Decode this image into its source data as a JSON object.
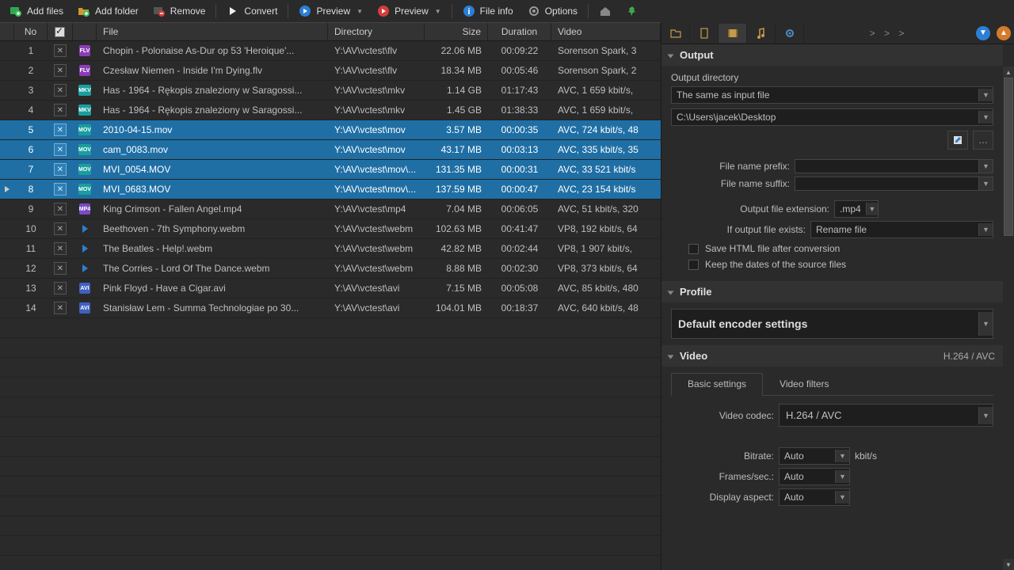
{
  "toolbar": {
    "add_files": "Add files",
    "add_folder": "Add folder",
    "remove": "Remove",
    "convert": "Convert",
    "preview1": "Preview",
    "preview2": "Preview",
    "file_info": "File info",
    "options": "Options"
  },
  "headers": {
    "no": "No",
    "file": "File",
    "directory": "Directory",
    "size": "Size",
    "duration": "Duration",
    "video": "Video"
  },
  "rows": [
    {
      "no": "1",
      "type": "flv",
      "file": "Chopin - Polonaise As-Dur op 53 'Heroique'...",
      "dir": "Y:\\AV\\vctest\\flv",
      "size": "22.06 MB",
      "dur": "00:09:22",
      "video": "Sorenson Spark, 3",
      "sel": false
    },
    {
      "no": "2",
      "type": "flv",
      "file": "Czesław Niemen - Inside I'm Dying.flv",
      "dir": "Y:\\AV\\vctest\\flv",
      "size": "18.34 MB",
      "dur": "00:05:46",
      "video": "Sorenson Spark, 2",
      "sel": false
    },
    {
      "no": "3",
      "type": "mkv",
      "file": "Has - 1964 - Rękopis znaleziony w Saragossi...",
      "dir": "Y:\\AV\\vctest\\mkv",
      "size": "1.14 GB",
      "dur": "01:17:43",
      "video": "AVC, 1 659 kbit/s,",
      "sel": false
    },
    {
      "no": "4",
      "type": "mkv",
      "file": "Has - 1964 - Rękopis znaleziony w Saragossi...",
      "dir": "Y:\\AV\\vctest\\mkv",
      "size": "1.45 GB",
      "dur": "01:38:33",
      "video": "AVC, 1 659 kbit/s,",
      "sel": false
    },
    {
      "no": "5",
      "type": "mov",
      "file": "2010-04-15.mov",
      "dir": "Y:\\AV\\vctest\\mov",
      "size": "3.57 MB",
      "dur": "00:00:35",
      "video": "AVC, 724 kbit/s, 48",
      "sel": true
    },
    {
      "no": "6",
      "type": "mov",
      "file": "cam_0083.mov",
      "dir": "Y:\\AV\\vctest\\mov",
      "size": "43.17 MB",
      "dur": "00:03:13",
      "video": "AVC, 335 kbit/s, 35",
      "sel": true
    },
    {
      "no": "7",
      "type": "mov",
      "file": "MVI_0054.MOV",
      "dir": "Y:\\AV\\vctest\\mov\\...",
      "size": "131.35 MB",
      "dur": "00:00:31",
      "video": "AVC, 33 521 kbit/s",
      "sel": true
    },
    {
      "no": "8",
      "type": "mov",
      "file": "MVI_0683.MOV",
      "dir": "Y:\\AV\\vctest\\mov\\...",
      "size": "137.59 MB",
      "dur": "00:00:47",
      "video": "AVC, 23 154 kbit/s",
      "sel": true,
      "current": true
    },
    {
      "no": "9",
      "type": "mp4",
      "file": "King Crimson - Fallen Angel.mp4",
      "dir": "Y:\\AV\\vctest\\mp4",
      "size": "7.04 MB",
      "dur": "00:06:05",
      "video": "AVC, 51 kbit/s, 320",
      "sel": false
    },
    {
      "no": "10",
      "type": "webm",
      "file": "Beethoven - 7th Symphony.webm",
      "dir": "Y:\\AV\\vctest\\webm",
      "size": "102.63 MB",
      "dur": "00:41:47",
      "video": "VP8, 192 kbit/s, 64",
      "sel": false
    },
    {
      "no": "11",
      "type": "webm",
      "file": "The Beatles - Help!.webm",
      "dir": "Y:\\AV\\vctest\\webm",
      "size": "42.82 MB",
      "dur": "00:02:44",
      "video": "VP8, 1 907 kbit/s,",
      "sel": false
    },
    {
      "no": "12",
      "type": "webm",
      "file": "The Corries - Lord Of The Dance.webm",
      "dir": "Y:\\AV\\vctest\\webm",
      "size": "8.88 MB",
      "dur": "00:02:30",
      "video": "VP8, 373 kbit/s, 64",
      "sel": false
    },
    {
      "no": "13",
      "type": "avi",
      "file": "Pink Floyd - Have a Cigar.avi",
      "dir": "Y:\\AV\\vctest\\avi",
      "size": "7.15 MB",
      "dur": "00:05:08",
      "video": "AVC, 85 kbit/s, 480",
      "sel": false
    },
    {
      "no": "14",
      "type": "avi",
      "file": "Stanisław Lem - Summa Technologiae po 30...",
      "dir": "Y:\\AV\\vctest\\avi",
      "size": "104.01 MB",
      "dur": "00:18:37",
      "video": "AVC, 640 kbit/s, 48",
      "sel": false
    }
  ],
  "side": {
    "expander": "> > >",
    "output_title": "Output",
    "output_dir_label": "Output directory",
    "output_dir_value": "The same as input file",
    "output_path": "C:\\Users\\jacek\\Desktop",
    "prefix_label": "File name prefix:",
    "suffix_label": "File name suffix:",
    "ext_label": "Output file extension:",
    "ext_value": ".mp4",
    "exists_label": "If output file exists:",
    "exists_value": "Rename file",
    "save_html": "Save HTML file after conversion",
    "keep_dates": "Keep the dates of the source files",
    "profile_title": "Profile",
    "profile_value": "Default encoder settings",
    "video_title": "Video",
    "video_codec_tag": "H.264 / AVC",
    "tab_basic": "Basic settings",
    "tab_filters": "Video filters",
    "codec_label": "Video codec:",
    "codec_value": "H.264 / AVC",
    "bitrate_label": "Bitrate:",
    "bitrate_value": "Auto",
    "bitrate_unit": "kbit/s",
    "fps_label": "Frames/sec.:",
    "fps_value": "Auto",
    "aspect_label": "Display aspect:",
    "aspect_value": "Auto"
  }
}
